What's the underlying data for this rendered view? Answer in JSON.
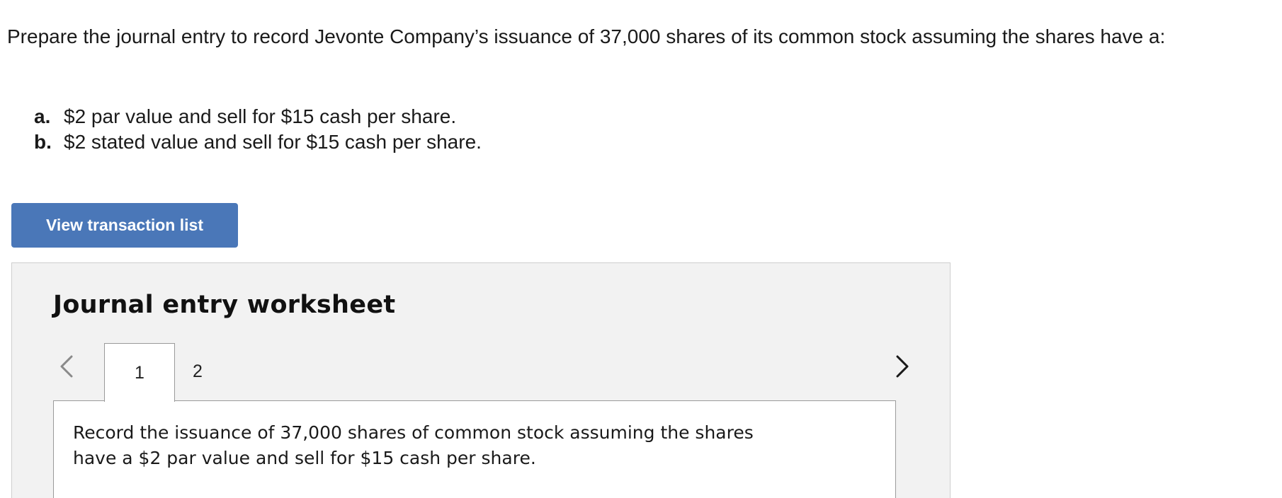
{
  "question": {
    "intro": "Prepare the journal entry to record Jevonte Company’s issuance of 37,000 shares of its common stock assuming the shares have a:",
    "parts": [
      {
        "letter": "a.",
        "text": "$2 par value and sell for $15 cash per share."
      },
      {
        "letter": "b.",
        "text": "$2 stated value and sell for $15 cash per share."
      }
    ]
  },
  "view_button": {
    "label": "View transaction list"
  },
  "worksheet": {
    "title": "Journal entry worksheet",
    "tabs": [
      {
        "label": "1",
        "active": true
      },
      {
        "label": "2",
        "active": false
      }
    ],
    "prev_icon": "chevron-left-icon",
    "next_icon": "chevron-right-icon",
    "instruction": "Record the issuance of 37,000 shares of common stock assuming the shares have a $2 par value and sell for $15 cash per share."
  },
  "colors": {
    "button_bg": "#4a77b8",
    "worksheet_bg": "#f2f2f2",
    "border": "#9a9a9a"
  }
}
